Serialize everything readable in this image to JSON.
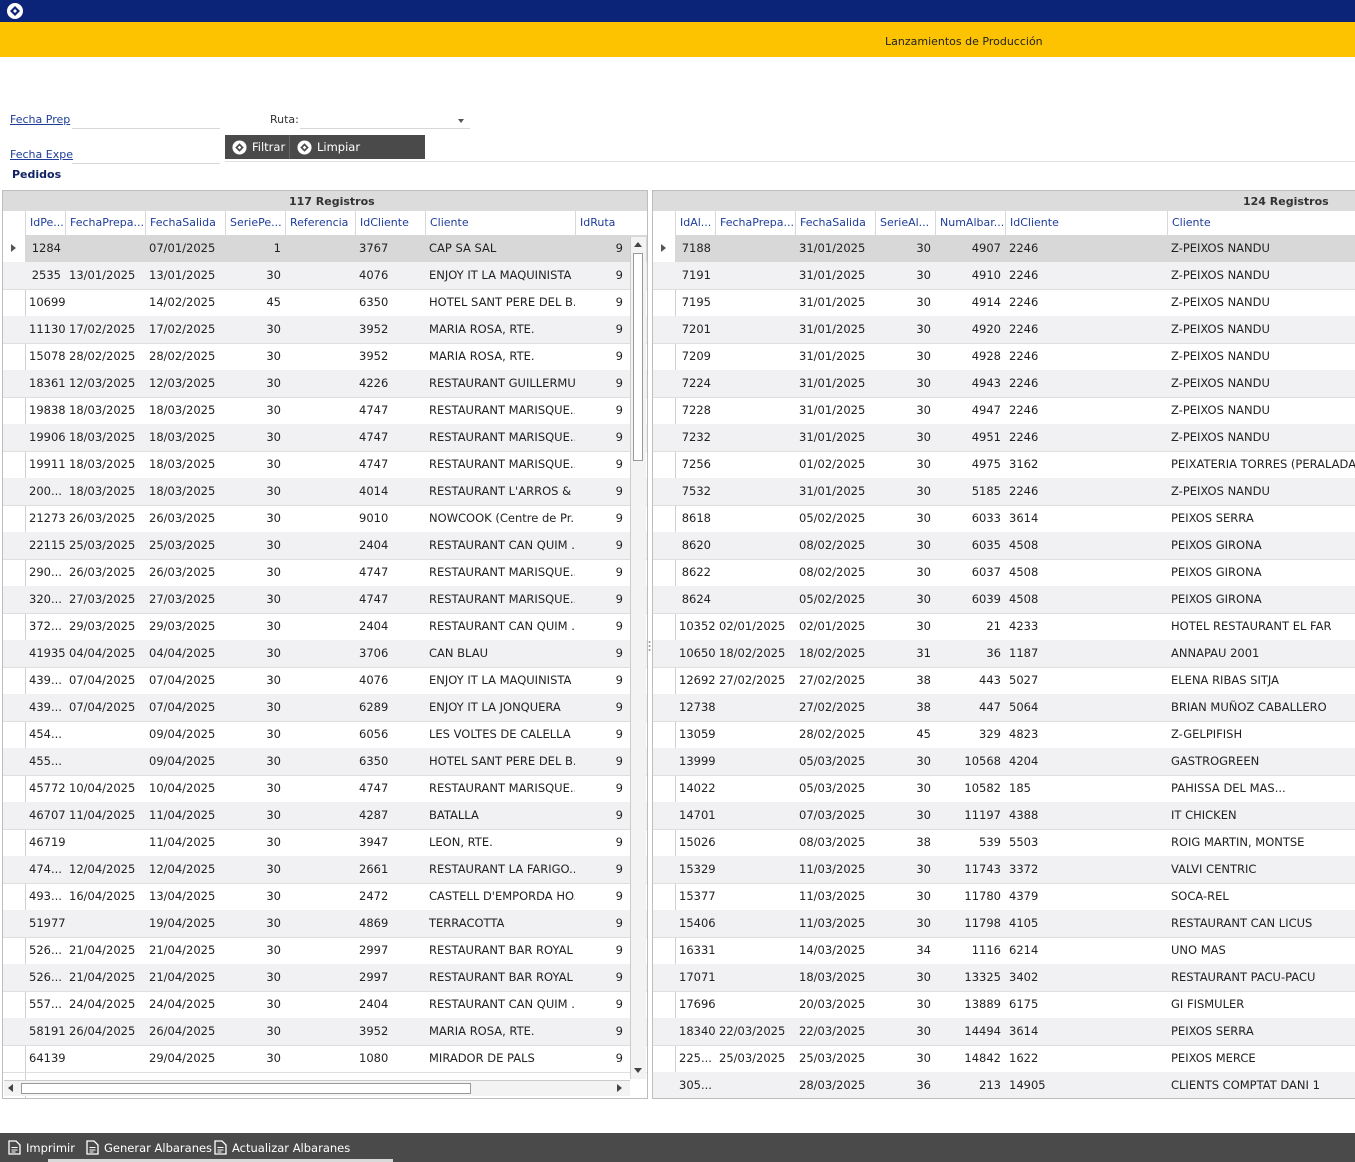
{
  "app": {
    "title": "Lanzamientos de Producción"
  },
  "filters": {
    "fecha_prep_label": "Fecha Prep",
    "fecha_expe_label": "Fecha Expe",
    "ruta_label": "Ruta:",
    "filtrar_label": "Filtrar",
    "limpiar_label": "Limpiar"
  },
  "section_title": "Pedidos",
  "left_grid": {
    "count_label": "117 Registros",
    "columns": [
      "IdPe...",
      "FechaPrepa...",
      "FechaSalida",
      "SeriePe...",
      "Referencia",
      "IdCliente",
      "Cliente",
      "IdRuta"
    ],
    "rows": [
      [
        "1284",
        "",
        "07/01/2025",
        "1",
        "",
        "3767",
        "CAP SA SAL",
        "9"
      ],
      [
        "2535",
        "13/01/2025",
        "13/01/2025",
        "30",
        "",
        "4076",
        "ENJOY IT LA MAQUINISTA",
        "9"
      ],
      [
        "10699",
        "",
        "14/02/2025",
        "45",
        "",
        "6350",
        "HOTEL SANT PERE DEL B...",
        "9"
      ],
      [
        "11130",
        "17/02/2025",
        "17/02/2025",
        "30",
        "",
        "3952",
        "MARIA ROSA, RTE.",
        "9"
      ],
      [
        "15078",
        "28/02/2025",
        "28/02/2025",
        "30",
        "",
        "3952",
        "MARIA ROSA, RTE.",
        "9"
      ],
      [
        "18361",
        "12/03/2025",
        "12/03/2025",
        "30",
        "",
        "4226",
        "RESTAURANT GUILLERMU",
        "9"
      ],
      [
        "19838",
        "18/03/2025",
        "18/03/2025",
        "30",
        "",
        "4747",
        "RESTAURANT MARISQUE...",
        "9"
      ],
      [
        "19906",
        "18/03/2025",
        "18/03/2025",
        "30",
        "",
        "4747",
        "RESTAURANT MARISQUE...",
        "9"
      ],
      [
        "19911",
        "18/03/2025",
        "18/03/2025",
        "30",
        "",
        "4747",
        "RESTAURANT MARISQUE...",
        "9"
      ],
      [
        "200...",
        "18/03/2025",
        "18/03/2025",
        "30",
        "",
        "4014",
        "RESTAURANT L'ARROS & ...",
        "9"
      ],
      [
        "21273",
        "26/03/2025",
        "26/03/2025",
        "30",
        "",
        "9010",
        "NOWCOOK (Centre de Pr...",
        "9"
      ],
      [
        "22115",
        "25/03/2025",
        "25/03/2025",
        "30",
        "",
        "2404",
        "RESTAURANT CAN QUIM ...",
        "9"
      ],
      [
        "290...",
        "26/03/2025",
        "26/03/2025",
        "30",
        "",
        "4747",
        "RESTAURANT MARISQUE...",
        "9"
      ],
      [
        "320...",
        "27/03/2025",
        "27/03/2025",
        "30",
        "",
        "4747",
        "RESTAURANT MARISQUE...",
        "9"
      ],
      [
        "372...",
        "29/03/2025",
        "29/03/2025",
        "30",
        "",
        "2404",
        "RESTAURANT CAN QUIM ...",
        "9"
      ],
      [
        "41935",
        "04/04/2025",
        "04/04/2025",
        "30",
        "",
        "3706",
        "CAN BLAU",
        "9"
      ],
      [
        "439...",
        "07/04/2025",
        "07/04/2025",
        "30",
        "",
        "4076",
        "ENJOY IT LA MAQUINISTA",
        "9"
      ],
      [
        "439...",
        "07/04/2025",
        "07/04/2025",
        "30",
        "",
        "6289",
        "ENJOY IT LA JONQUERA",
        "9"
      ],
      [
        "454...",
        "",
        "09/04/2025",
        "30",
        "",
        "6056",
        "LES VOLTES DE CALELLA",
        "9"
      ],
      [
        "455...",
        "",
        "09/04/2025",
        "30",
        "",
        "6350",
        "HOTEL SANT PERE DEL B...",
        "9"
      ],
      [
        "45772",
        "10/04/2025",
        "10/04/2025",
        "30",
        "",
        "4747",
        "RESTAURANT MARISQUE...",
        "9"
      ],
      [
        "46707",
        "11/04/2025",
        "11/04/2025",
        "30",
        "",
        "4287",
        "BATALLA",
        "9"
      ],
      [
        "46719",
        "",
        "11/04/2025",
        "30",
        "",
        "3947",
        "LEON, RTE.",
        "9"
      ],
      [
        "474...",
        "12/04/2025",
        "12/04/2025",
        "30",
        "",
        "2661",
        "RESTAURANT LA FARIGO...",
        "9"
      ],
      [
        "493...",
        "16/04/2025",
        "13/04/2025",
        "30",
        "",
        "2472",
        "CASTELL D'EMPORDA HO...",
        "9"
      ],
      [
        "51977",
        "",
        "19/04/2025",
        "30",
        "",
        "4869",
        "TERRACOTTA",
        "9"
      ],
      [
        "526...",
        "21/04/2025",
        "21/04/2025",
        "30",
        "",
        "2997",
        "RESTAURANT BAR ROYAL",
        "9"
      ],
      [
        "526...",
        "21/04/2025",
        "21/04/2025",
        "30",
        "",
        "2997",
        "RESTAURANT BAR ROYAL",
        "9"
      ],
      [
        "557...",
        "24/04/2025",
        "24/04/2025",
        "30",
        "",
        "2404",
        "RESTAURANT CAN QUIM ...",
        "9"
      ],
      [
        "58191",
        "26/04/2025",
        "26/04/2025",
        "30",
        "",
        "3952",
        "MARIA ROSA, RTE.",
        "9"
      ],
      [
        "64139",
        "",
        "29/04/2025",
        "30",
        "",
        "1080",
        "MIRADOR DE PALS",
        "9"
      ]
    ]
  },
  "right_grid": {
    "count_label": "124 Registros",
    "columns": [
      "IdAl...",
      "FechaPrepa...",
      "FechaSalida",
      "SerieAl...",
      "NumAlbar...",
      "IdCliente",
      "Cliente"
    ],
    "rows": [
      [
        "7188",
        "",
        "31/01/2025",
        "30",
        "4907",
        "2246",
        "Z-PEIXOS NANDU"
      ],
      [
        "7191",
        "",
        "31/01/2025",
        "30",
        "4910",
        "2246",
        "Z-PEIXOS NANDU"
      ],
      [
        "7195",
        "",
        "31/01/2025",
        "30",
        "4914",
        "2246",
        "Z-PEIXOS NANDU"
      ],
      [
        "7201",
        "",
        "31/01/2025",
        "30",
        "4920",
        "2246",
        "Z-PEIXOS NANDU"
      ],
      [
        "7209",
        "",
        "31/01/2025",
        "30",
        "4928",
        "2246",
        "Z-PEIXOS NANDU"
      ],
      [
        "7224",
        "",
        "31/01/2025",
        "30",
        "4943",
        "2246",
        "Z-PEIXOS NANDU"
      ],
      [
        "7228",
        "",
        "31/01/2025",
        "30",
        "4947",
        "2246",
        "Z-PEIXOS NANDU"
      ],
      [
        "7232",
        "",
        "31/01/2025",
        "30",
        "4951",
        "2246",
        "Z-PEIXOS NANDU"
      ],
      [
        "7256",
        "",
        "01/02/2025",
        "30",
        "4975",
        "3162",
        "PEIXATERIA TORRES (PERALADA)"
      ],
      [
        "7532",
        "",
        "31/01/2025",
        "30",
        "5185",
        "2246",
        "Z-PEIXOS NANDU"
      ],
      [
        "8618",
        "",
        "05/02/2025",
        "30",
        "6033",
        "3614",
        "PEIXOS SERRA"
      ],
      [
        "8620",
        "",
        "08/02/2025",
        "30",
        "6035",
        "4508",
        "PEIXOS GIRONA"
      ],
      [
        "8622",
        "",
        "08/02/2025",
        "30",
        "6037",
        "4508",
        "PEIXOS GIRONA"
      ],
      [
        "8624",
        "",
        "05/02/2025",
        "30",
        "6039",
        "4508",
        "PEIXOS GIRONA"
      ],
      [
        "10352",
        "02/01/2025",
        "02/01/2025",
        "30",
        "21",
        "4233",
        "HOTEL RESTAURANT EL FAR"
      ],
      [
        "10650",
        "18/02/2025",
        "18/02/2025",
        "31",
        "36",
        "1187",
        "ANNAPAU 2001"
      ],
      [
        "12692",
        "27/02/2025",
        "27/02/2025",
        "38",
        "443",
        "5027",
        "ELENA RIBAS SITJA"
      ],
      [
        "12738",
        "",
        "27/02/2025",
        "38",
        "447",
        "5064",
        "BRIAN MUÑOZ CABALLERO"
      ],
      [
        "13059",
        "",
        "28/02/2025",
        "45",
        "329",
        "4823",
        "Z-GELPIFISH"
      ],
      [
        "13999",
        "",
        "05/03/2025",
        "30",
        "10568",
        "4204",
        "GASTROGREEN"
      ],
      [
        "14022",
        "",
        "05/03/2025",
        "30",
        "10582",
        "185",
        "PAHISSA DEL MAS..."
      ],
      [
        "14701",
        "",
        "07/03/2025",
        "30",
        "11197",
        "4388",
        "IT CHICKEN"
      ],
      [
        "15026",
        "",
        "08/03/2025",
        "38",
        "539",
        "5503",
        "ROIG MARTIN, MONTSE"
      ],
      [
        "15329",
        "",
        "11/03/2025",
        "30",
        "11743",
        "3372",
        "VALVI CENTRIC"
      ],
      [
        "15377",
        "",
        "11/03/2025",
        "30",
        "11780",
        "4379",
        "SOCA-REL"
      ],
      [
        "15406",
        "",
        "11/03/2025",
        "30",
        "11798",
        "4105",
        "RESTAURANT CAN LICUS"
      ],
      [
        "16331",
        "",
        "14/03/2025",
        "34",
        "1116",
        "6214",
        "UNO MAS"
      ],
      [
        "17071",
        "",
        "18/03/2025",
        "30",
        "13325",
        "3402",
        "RESTAURANT PACU-PACU"
      ],
      [
        "17696",
        "",
        "20/03/2025",
        "30",
        "13889",
        "6175",
        "GI FISMULER"
      ],
      [
        "18340",
        "22/03/2025",
        "22/03/2025",
        "30",
        "14494",
        "3614",
        "PEIXOS SERRA"
      ],
      [
        "225...",
        "25/03/2025",
        "25/03/2025",
        "30",
        "14842",
        "1622",
        "PEIXOS MERCE"
      ],
      [
        "305...",
        "",
        "28/03/2025",
        "36",
        "213",
        "14905",
        "CLIENTS COMPTAT DANI 1"
      ]
    ]
  },
  "footer": {
    "imprimir_label": "Imprimir",
    "generar_label": "Generar Albaranes",
    "actualizar_label": "Actualizar Albaranes"
  }
}
